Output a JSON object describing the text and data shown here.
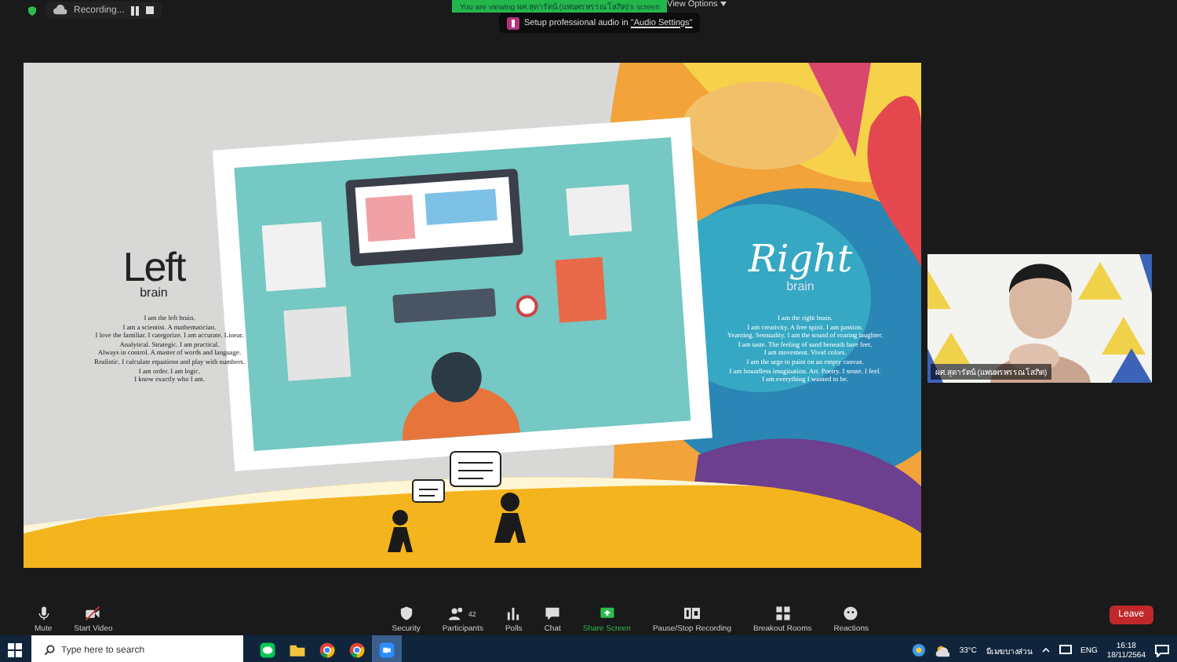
{
  "top_bar": {
    "recording": "Recording...",
    "viewing_banner": "You are viewing ผศ.สุดารัตน์ (แพนพรพรรณโสภิต)'s screen",
    "view_options": "View Options",
    "audio_tip": "Setup professional audio in ",
    "audio_link": "\"Audio Settings\""
  },
  "slide": {
    "left_title": "Left",
    "left_subtitle": "brain",
    "left_body": "I am the left brain.\nI am a scientist. A mathematician.\nI love the familiar. I categorize. I am accurate. Linear.\nAnalytical. Strategic. I am practical.\nAlways in control. A master of words and language.\nRealistic. I calculate equations and play with numbers.\nI am order. I am logic.\nI know exactly who I am.",
    "right_title": "Right",
    "right_subtitle": "brain",
    "right_body": "I am the right brain.\nI am creativity. A free spirit. I am passion.\nYearning. Sensuality. I am the sound of roaring laughter.\nI am taste. The feeling of sand beneath bare feet.\nI am movement. Vivid colors.\nI am the urge to paint on an empty canvas.\nI am boundless imagination. Art. Poetry. I sense. I feel.\nI am everything I wanted to be."
  },
  "video": {
    "name": "ผศ.สุดารัตน์ (แพนพรพรรณโสภิต)"
  },
  "toolbar": {
    "items": [
      {
        "kind": "mic",
        "label": "Mute"
      },
      {
        "kind": "video",
        "label": "Start Video"
      },
      {
        "kind": "security",
        "label": "Security"
      },
      {
        "kind": "participants",
        "label": "Participants",
        "count": "42"
      },
      {
        "kind": "polls",
        "label": "Polls"
      },
      {
        "kind": "chat",
        "label": "Chat"
      },
      {
        "kind": "share",
        "label": "Share Screen"
      },
      {
        "kind": "record",
        "label": "Pause/Stop Recording"
      },
      {
        "kind": "breakout",
        "label": "Breakout Rooms"
      },
      {
        "kind": "reactions",
        "label": "Reactions"
      }
    ],
    "leave": "Leave"
  },
  "taskbar": {
    "search_placeholder": "Type here to search",
    "apps": [
      {
        "kind": "line",
        "selected": false
      },
      {
        "kind": "folder",
        "selected": false
      },
      {
        "kind": "chrome",
        "selected": false
      },
      {
        "kind": "chrome",
        "selected": false
      },
      {
        "kind": "zoom",
        "selected": true
      }
    ],
    "temperature": "33°C",
    "weather": "มีเมฆบางส่วน",
    "language": "ENG",
    "time": "16:18",
    "date": "18/11/2564"
  }
}
